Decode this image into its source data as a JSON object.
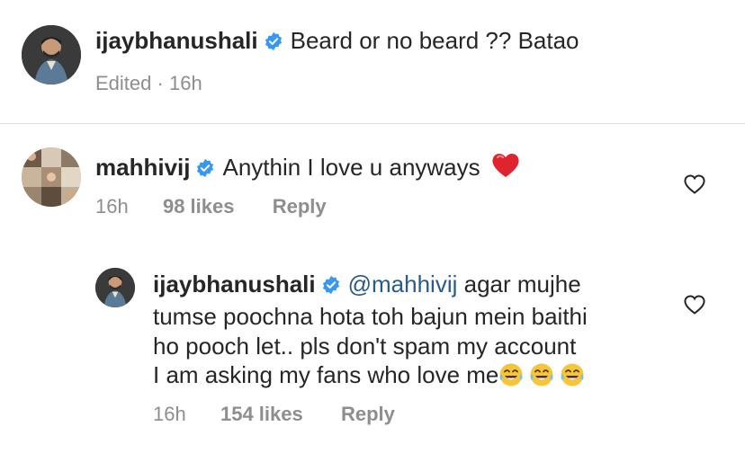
{
  "caption": {
    "username": "ijaybhanushali",
    "text": "Beard or no beard ?? Batao",
    "edited_label": "Edited",
    "separator": "·",
    "time": "16h"
  },
  "comments": [
    {
      "username": "mahhivij",
      "text": "Anythin I love u anyways",
      "emoji": "red-heart",
      "time": "16h",
      "likes": "98 likes",
      "reply_label": "Reply"
    }
  ],
  "replies": [
    {
      "username": "ijaybhanushali",
      "mention": "@mahhivij",
      "line1": "agar mujhe",
      "line2": "tumse poochna hota toh bajun mein baithi",
      "line3": "ho pooch let.. pls don't spam my account",
      "line4": "I am asking my fans who love me",
      "emojis": [
        "face-with-tears-of-joy",
        "face-with-tears-of-joy",
        "face-with-tears-of-joy"
      ],
      "time": "16h",
      "likes": "154 likes",
      "reply_label": "Reply"
    }
  ],
  "colors": {
    "verified_blue": "#3897f0",
    "meta_gray": "#8e8e8e",
    "mention_blue": "#2a5a8c",
    "divider": "#dbdbdb"
  }
}
